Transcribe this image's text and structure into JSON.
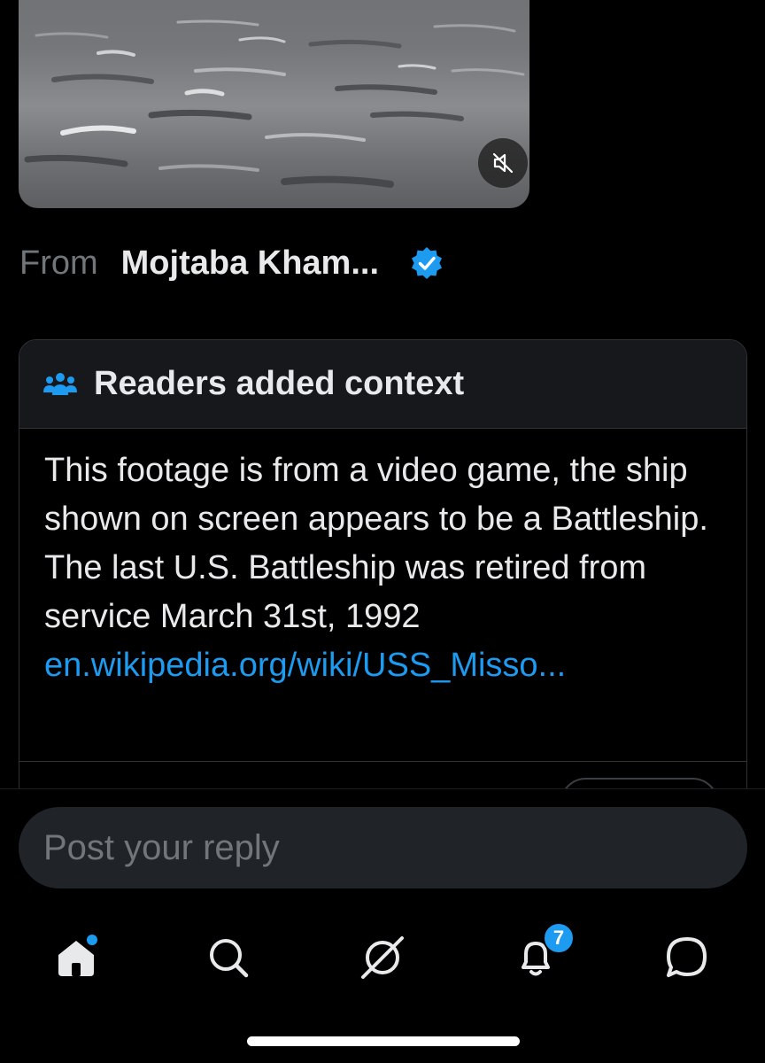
{
  "tweet": {
    "from_label": "From",
    "from_name": "Mojtaba Kham...",
    "verified_icon": "verified-badge-icon",
    "media": {
      "mute_icon": "speaker-muted-icon"
    }
  },
  "community_note": {
    "header_icon": "people-icon",
    "title": "Readers added context",
    "body": "This footage is from a video game, the ship shown on screen appears to be a Battleship. The last U.S. Battleship was retired from service March 31st, 1992",
    "link": "en.wikipedia.org/wiki/USS_Misso..."
  },
  "reply": {
    "placeholder": "Post your reply"
  },
  "tabbar": {
    "items": [
      {
        "name": "home",
        "icon": "home-icon",
        "has_dot": true
      },
      {
        "name": "search",
        "icon": "search-icon"
      },
      {
        "name": "grok",
        "icon": "grok-icon"
      },
      {
        "name": "notifications",
        "icon": "bell-icon",
        "badge": "7"
      },
      {
        "name": "messages",
        "icon": "message-icon"
      }
    ]
  },
  "colors": {
    "background": "#000000",
    "accent": "#1d9bf0",
    "text_primary": "#e7e9ea",
    "text_secondary": "#71767b"
  }
}
